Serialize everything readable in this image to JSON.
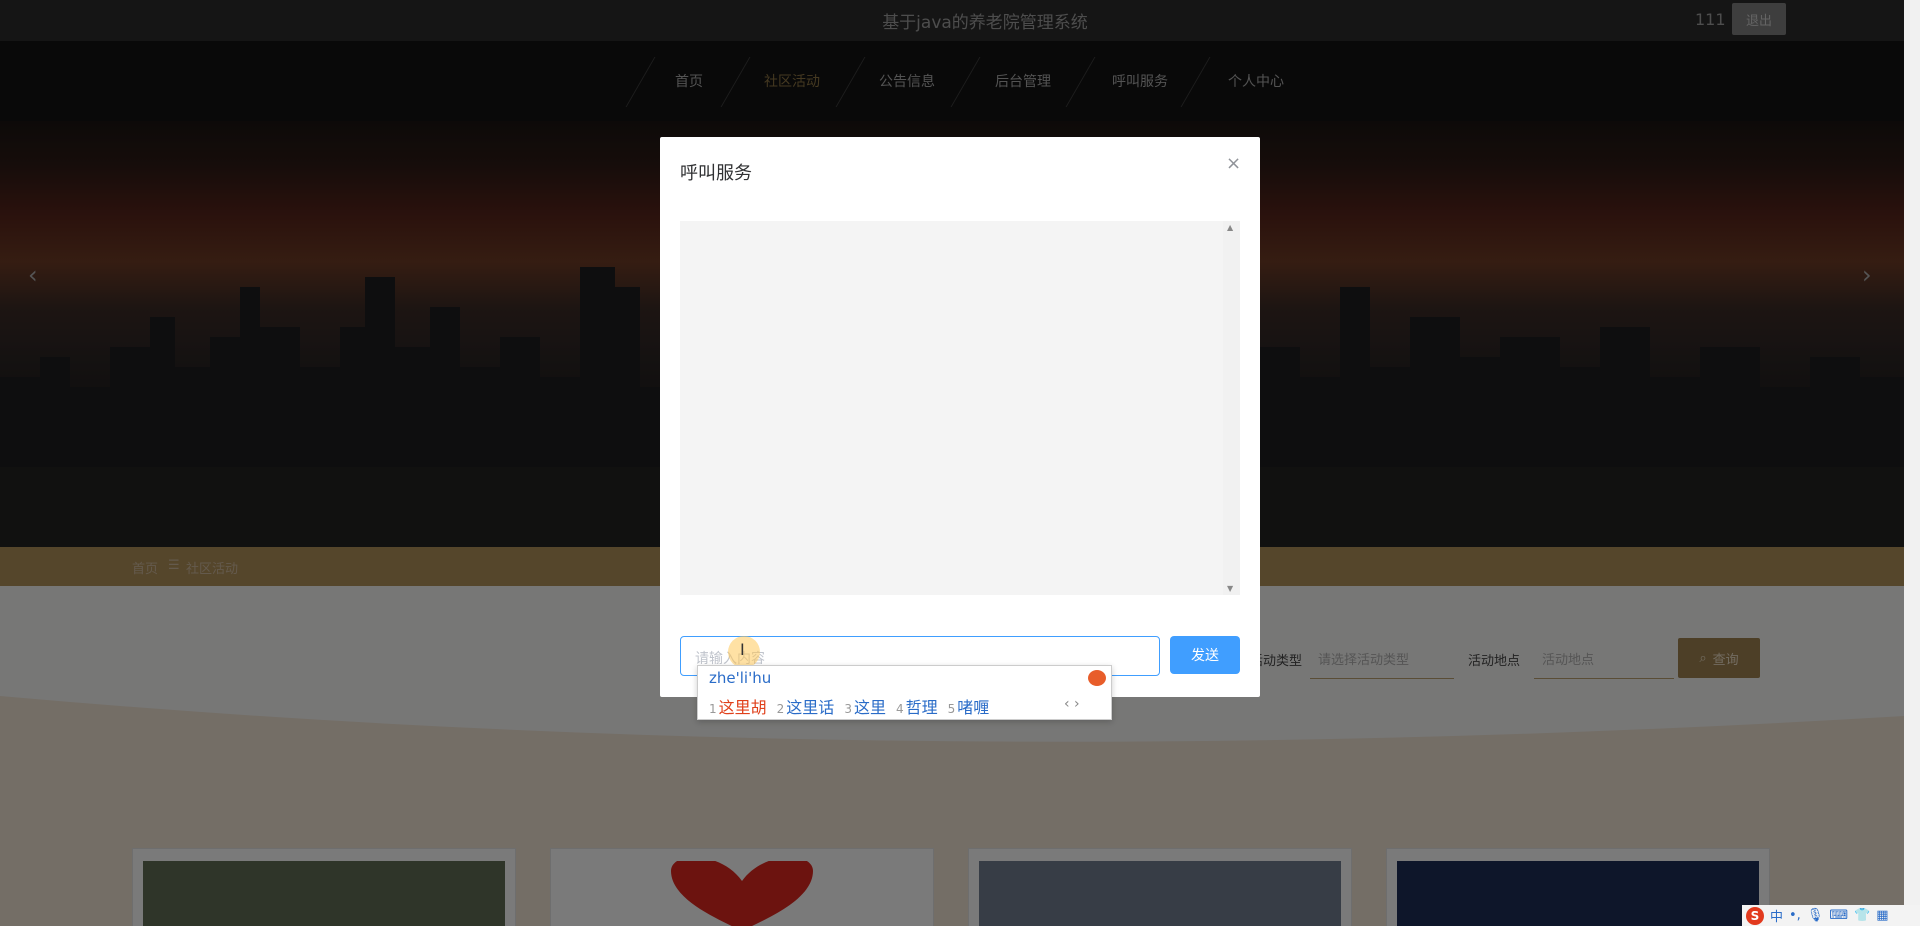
{
  "header": {
    "site_title": "基于java的养老院管理系统",
    "user_name": "111",
    "logout_label": "退出"
  },
  "nav": {
    "items": [
      {
        "label": "首页"
      },
      {
        "label": "社区活动",
        "active": true
      },
      {
        "label": "公告信息"
      },
      {
        "label": "后台管理"
      },
      {
        "label": "呼叫服务"
      },
      {
        "label": "个人中心"
      }
    ]
  },
  "banner": {
    "prev_icon": "‹",
    "next_icon": "›"
  },
  "breadcrumb": {
    "home": "首页",
    "separator": "☰",
    "current": "社区活动"
  },
  "filters": {
    "type_label": "活动类型",
    "type_placeholder": "请选择活动类型",
    "place_label": "活动地点",
    "place_placeholder": "活动地点",
    "query_label": "查询"
  },
  "dialog": {
    "title": "呼叫服务",
    "close_icon": "×",
    "input_placeholder": "请输入内容",
    "send_label": "发送"
  },
  "ime": {
    "pinyin": "zhe'li'hu",
    "candidates": [
      {
        "num": "1",
        "text": "这里胡"
      },
      {
        "num": "2",
        "text": "这里话"
      },
      {
        "num": "3",
        "text": "这里"
      },
      {
        "num": "4",
        "text": "哲理"
      },
      {
        "num": "5",
        "text": "啫喱"
      }
    ],
    "nav": "‹ ›"
  },
  "tray": {
    "logo": "S",
    "mode": "中"
  },
  "colors": {
    "accent": "#aa8c57",
    "primary_button": "#409eff",
    "nav_active": "#8a7242"
  }
}
